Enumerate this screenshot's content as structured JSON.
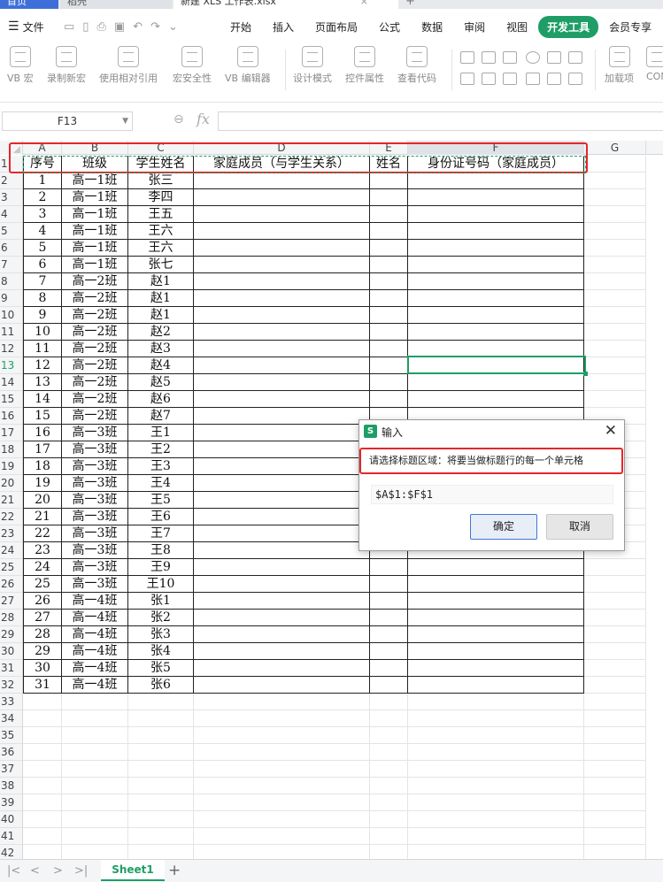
{
  "tabs": {
    "home": "首页",
    "docer": "稻壳",
    "doc": "新建 XLS 工作表.xlsx"
  },
  "menu": {
    "file": "文件",
    "items": [
      "开始",
      "插入",
      "页面布局",
      "公式",
      "数据",
      "审阅",
      "视图",
      "开发工具",
      "会员专享"
    ],
    "active": "开发工具"
  },
  "ribbon": {
    "vb_macro": "VB 宏",
    "record_macro": "录制新宏",
    "relative_ref": "使用相对引用",
    "macro_security": "宏安全性",
    "vb_editor": "VB 编辑器",
    "design_mode": "设计模式",
    "control_props": "控件属性",
    "view_code": "查看代码",
    "addins": "加载项",
    "com": "COM"
  },
  "formula": {
    "cell_ref": "F13",
    "fx": "fx",
    "value": ""
  },
  "columns": [
    "A",
    "B",
    "C",
    "D",
    "E",
    "F",
    "G"
  ],
  "header_row": [
    "序号",
    "班级",
    "学生姓名",
    "家庭成员（与学生关系）",
    "姓名",
    "身份证号码（家庭成员）"
  ],
  "rows": [
    [
      "1",
      "高一1班",
      "张三"
    ],
    [
      "2",
      "高一1班",
      "李四"
    ],
    [
      "3",
      "高一1班",
      "王五"
    ],
    [
      "4",
      "高一1班",
      "王六"
    ],
    [
      "5",
      "高一1班",
      "王六"
    ],
    [
      "6",
      "高一1班",
      "张七"
    ],
    [
      "7",
      "高一2班",
      "赵1"
    ],
    [
      "8",
      "高一2班",
      "赵1"
    ],
    [
      "9",
      "高一2班",
      "赵1"
    ],
    [
      "10",
      "高一2班",
      "赵2"
    ],
    [
      "11",
      "高一2班",
      "赵3"
    ],
    [
      "12",
      "高一2班",
      "赵4"
    ],
    [
      "13",
      "高一2班",
      "赵5"
    ],
    [
      "14",
      "高一2班",
      "赵6"
    ],
    [
      "15",
      "高一2班",
      "赵7"
    ],
    [
      "16",
      "高一3班",
      "王1"
    ],
    [
      "17",
      "高一3班",
      "王2"
    ],
    [
      "18",
      "高一3班",
      "王3"
    ],
    [
      "19",
      "高一3班",
      "王4"
    ],
    [
      "20",
      "高一3班",
      "王5"
    ],
    [
      "21",
      "高一3班",
      "王6"
    ],
    [
      "22",
      "高一3班",
      "王7"
    ],
    [
      "23",
      "高一3班",
      "王8"
    ],
    [
      "24",
      "高一3班",
      "王9"
    ],
    [
      "25",
      "高一3班",
      "王10"
    ],
    [
      "26",
      "高一4班",
      "张1"
    ],
    [
      "27",
      "高一4班",
      "张2"
    ],
    [
      "28",
      "高一4班",
      "张3"
    ],
    [
      "29",
      "高一4班",
      "张4"
    ],
    [
      "30",
      "高一4班",
      "张5"
    ],
    [
      "31",
      "高一4班",
      "张6"
    ]
  ],
  "row_numbers": [
    "1",
    "2",
    "3",
    "4",
    "5",
    "6",
    "7",
    "8",
    "9",
    "10",
    "11",
    "12",
    "13",
    "14",
    "15",
    "16",
    "17",
    "18",
    "19",
    "20",
    "21",
    "22",
    "23",
    "24",
    "25",
    "26",
    "27",
    "28",
    "29",
    "30",
    "31",
    "32",
    "33",
    "34",
    "35",
    "36",
    "37",
    "38",
    "39",
    "40",
    "41",
    "42"
  ],
  "sheet": {
    "name": "Sheet1"
  },
  "dialog": {
    "title": "输入",
    "prompt": "请选择标题区域：将要当做标题行的每一个单元格",
    "value": "$A$1:$F$1",
    "ok": "确定",
    "cancel": "取消"
  },
  "colors": {
    "accent": "#1e9e66",
    "highlight": "#e5262b",
    "primary_button": "#3f78d6"
  }
}
